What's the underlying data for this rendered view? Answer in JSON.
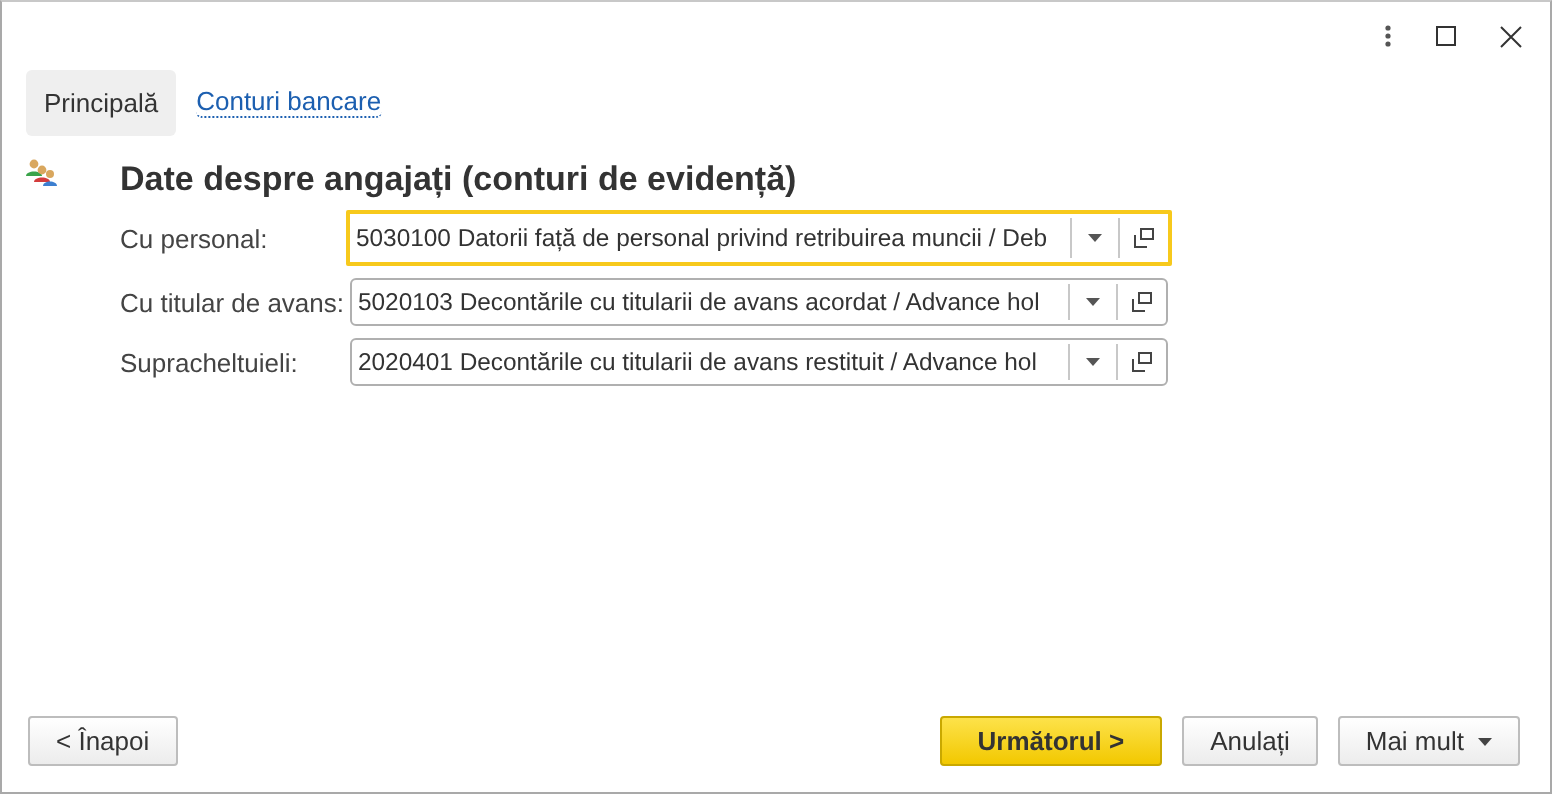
{
  "tabs": [
    {
      "label": "Principală",
      "selected": true
    },
    {
      "label": "Conturi bancare",
      "selected": false
    }
  ],
  "section": {
    "title": "Date despre angajați (conturi de evidență)"
  },
  "fields": [
    {
      "label": "Cu personal:",
      "value": "5030100 Datorii față de personal privind retribuirea muncii / Deb",
      "focused": true
    },
    {
      "label": "Cu titular de avans:",
      "value": "5020103 Decontările cu titularii de avans acordat / Advance hol",
      "focused": false
    },
    {
      "label": "Supracheltuieli:",
      "value": "2020401 Decontările cu titularii de avans restituit / Advance hol",
      "focused": false
    }
  ],
  "buttons": [
    {
      "label": "< Înapoi",
      "kind": "plain"
    },
    {
      "label": "Următorul >",
      "kind": "primary"
    },
    {
      "label": "Anulați",
      "kind": "plain"
    },
    {
      "label": "Mai mult",
      "kind": "menu"
    }
  ]
}
